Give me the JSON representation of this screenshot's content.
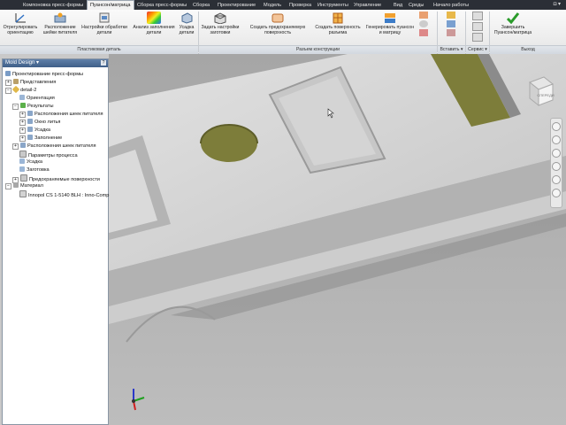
{
  "ribbon_tabs": [
    {
      "label": "Компоновка пресс-формы"
    },
    {
      "label": "Пуансон/матрица",
      "active": true
    },
    {
      "label": "Сборка пресс-формы"
    },
    {
      "label": "Сборка"
    },
    {
      "label": "Проектирование"
    },
    {
      "label": "Модель"
    },
    {
      "label": "Проверка"
    },
    {
      "label": "Инструменты"
    },
    {
      "label": "Управление"
    },
    {
      "label": "Вид"
    },
    {
      "label": "Среды"
    },
    {
      "label": "Начало работы"
    }
  ],
  "ribbon_buttons": {
    "orient": "Отрегулировать ориентацию",
    "gate": "Расположение шейки питателя",
    "process": "Настройки обработки детали",
    "fill": "Анализ заполнения детали",
    "shrink": "Усадка детали",
    "workpiece": "Задать настройки заготовки",
    "preshape": "Создать предохраняемую поверхность",
    "parting": "Создать поверхность разъема",
    "generate": "Генерировать пуансон и матрицу",
    "finish": "Завершить Пуансон/матрица"
  },
  "ribbon_groups": {
    "part": "Пластиковая деталь",
    "parting": "Разъем конструкции",
    "insert": "Вставить ▾",
    "service": "Сервис ▾",
    "exit": "Выход"
  },
  "browser": {
    "title": "Mold Design ▾",
    "help": "?",
    "rows": [
      "Проектирование пресс-формы",
      "Представления",
      "detail-2",
      "Ориентация",
      "Результаты",
      "Расположения шеек питателя",
      "Окно литья",
      "Усадка",
      "Заполнение",
      "Расположения шеек питателя",
      "Параметры процесса",
      "Усадка",
      "Заготовка",
      "Предохраняемые поверхности",
      "Материал",
      "Innopol CS 1-5140 BLH : Inno-Comp"
    ]
  },
  "viewcube_label": "СПЕРЕДИ",
  "colors": {
    "ribbon_accent": "#3f5f88",
    "face_olive": "#7d7d3a",
    "active_tab": "#f1f1f1"
  }
}
